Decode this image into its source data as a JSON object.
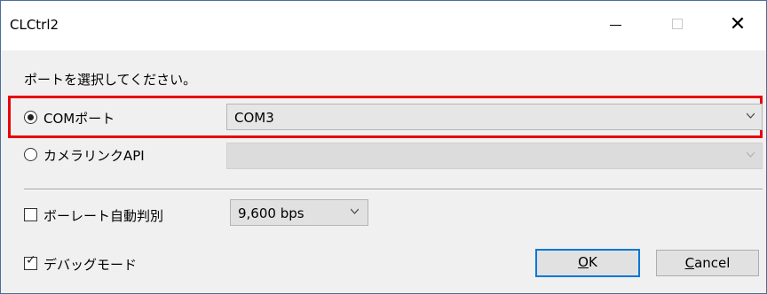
{
  "window": {
    "title": "CLCtrl2"
  },
  "titlebar": {
    "minimize_icon": "minimize-icon",
    "maximize_icon": "maximize-icon",
    "close_icon": "close-icon",
    "close_glyph": "✕"
  },
  "instruction": "ポートを選択してください。",
  "port_options": {
    "com": {
      "label": "COMポート",
      "selected": true,
      "value": "COM3"
    },
    "cameralink": {
      "label": "カメラリンクAPI",
      "selected": false,
      "value": ""
    }
  },
  "baud": {
    "auto_label": "ボーレート自動判別",
    "auto_checked": false,
    "value": "9,600 bps"
  },
  "debug": {
    "label": "デバッグモード",
    "checked": true,
    "check_glyph": "✓"
  },
  "buttons": {
    "ok": {
      "label_mnemonic": "O",
      "label_rest": "K"
    },
    "cancel": {
      "label_mnemonic": "C",
      "label_rest": "ancel"
    }
  },
  "colors": {
    "highlight": "#e8000a",
    "default_button_border": "#0078d7"
  }
}
